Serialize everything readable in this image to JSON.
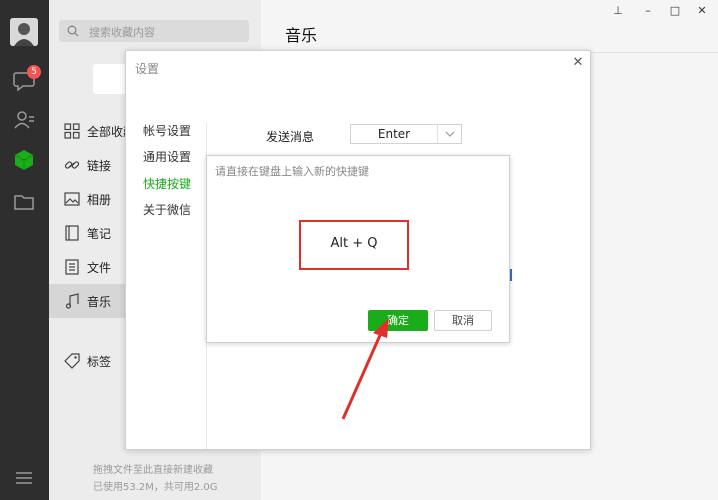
{
  "sidebar": {
    "chat_badge": "5",
    "icons": [
      "avatar",
      "chat-icon",
      "contacts-icon",
      "favorites-cube-icon",
      "folder-icon",
      "menu-icon"
    ]
  },
  "collections": {
    "search_placeholder": "搜索收藏内容",
    "items": [
      {
        "label": "全部收藏",
        "icon": "grid-icon"
      },
      {
        "label": "链接",
        "icon": "link-icon"
      },
      {
        "label": "相册",
        "icon": "image-icon"
      },
      {
        "label": "笔记",
        "icon": "note-icon"
      },
      {
        "label": "文件",
        "icon": "file-icon"
      },
      {
        "label": "音乐",
        "icon": "music-icon"
      },
      {
        "label": "标签",
        "icon": "tag-icon"
      }
    ],
    "hint": "拖拽文件至此直接新建收藏",
    "usage": "已使用53.2M，共可用2.0G"
  },
  "main": {
    "title": "音乐"
  },
  "window_controls": {
    "pin": "⊥",
    "minimize": "–",
    "maximize": "□",
    "close": "✕"
  },
  "settings": {
    "title": "设置",
    "close": "✕",
    "menu": [
      "帐号设置",
      "通用设置",
      "快捷按键",
      "关于微信"
    ],
    "active_menu": 2,
    "send_label": "发送消息",
    "send_value": "Enter"
  },
  "shortcut_dialog": {
    "prompt": "请直接在键盘上输入新的快捷键",
    "key_combo": "Alt + Q",
    "ok_label": "确定",
    "cancel_label": "取消"
  },
  "colors": {
    "accent_green": "#1aad19",
    "highlight_red": "#e0302c",
    "rail_dark": "#2e2e2e"
  }
}
